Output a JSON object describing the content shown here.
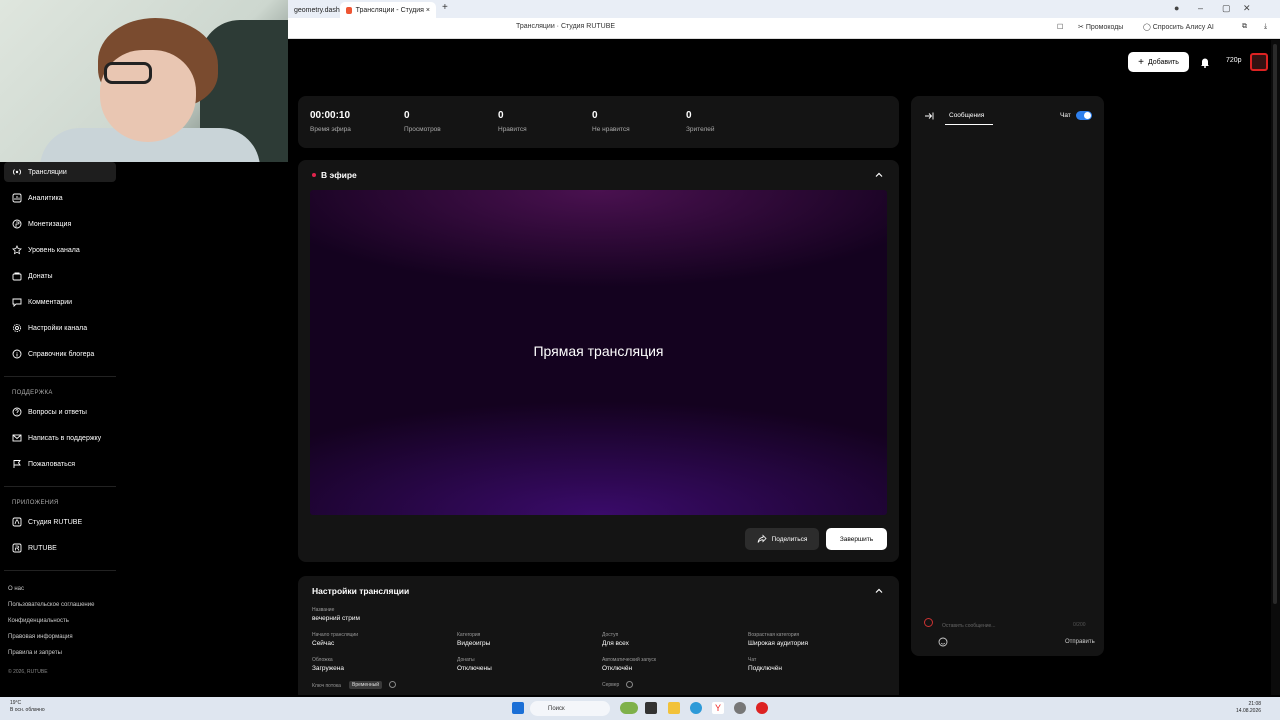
{
  "browser": {
    "tabs": [
      {
        "label": "geometry.dash"
      },
      {
        "label": "Трансляции - Студия ×"
      }
    ],
    "page_title": "Трансляции · Студия RUTUBE",
    "toolbar": {
      "promo_label": "Промокоды",
      "alice_label": "Спросить Алису AI"
    }
  },
  "header": {
    "add_label": "Добавить",
    "quality": "720p"
  },
  "sidebar": {
    "items": [
      {
        "label": "Трансляции",
        "icon": "broadcast-icon"
      },
      {
        "label": "Аналитика",
        "icon": "analytics-icon"
      },
      {
        "label": "Монетизация",
        "icon": "money-icon"
      },
      {
        "label": "Уровень канала",
        "icon": "star-icon"
      },
      {
        "label": "Донаты",
        "icon": "donate-icon"
      },
      {
        "label": "Комментарии",
        "icon": "comment-icon"
      },
      {
        "label": "Настройки канала",
        "icon": "gear-icon"
      },
      {
        "label": "Справочник блогера",
        "icon": "info-icon"
      }
    ],
    "support_label": "ПОДДЕРЖКА",
    "support_items": [
      {
        "label": "Вопросы и ответы",
        "icon": "question-icon"
      },
      {
        "label": "Написать в поддержку",
        "icon": "mail-icon"
      },
      {
        "label": "Пожаловаться",
        "icon": "flag-icon"
      }
    ],
    "apps_label": "ПРИЛОЖЕНИЯ",
    "apps_items": [
      {
        "label": "Студия RUTUBE",
        "icon": "grid-icon"
      },
      {
        "label": "RUTUBE",
        "icon": "grid-icon"
      }
    ],
    "footer_links": [
      "О нас",
      "Пользовательское соглашение",
      "Конфиденциальность",
      "Правовая информация",
      "Правила и запреты"
    ],
    "copyright": "© 2026, RUTUBE"
  },
  "stats": [
    {
      "value": "00:00:10",
      "label": "Время эфира"
    },
    {
      "value": "0",
      "label": "Просмотров"
    },
    {
      "value": "0",
      "label": "Нравится"
    },
    {
      "value": "0",
      "label": "Не нравится"
    },
    {
      "value": "0",
      "label": "Зрителей"
    }
  ],
  "live": {
    "title": "В эфире",
    "player_text": "Прямая трансляция",
    "share_label": "Поделиться",
    "end_label": "Завершить",
    "status_color": "#e0244c"
  },
  "settings": {
    "title": "Настройки трансляции",
    "name_label": "Название",
    "name_value": "вечерний стрим",
    "fields": [
      {
        "label": "Начало трансляции",
        "value": "Сейчас"
      },
      {
        "label": "Категория",
        "value": "Видеоигры"
      },
      {
        "label": "Доступ",
        "value": "Для всех"
      },
      {
        "label": "Возрастная категория",
        "value": "Широкая аудитория"
      },
      {
        "label": "Обложка",
        "value": "Загружена"
      },
      {
        "label": "Донаты",
        "value": "Отключены"
      },
      {
        "label": "Автоматический запуск",
        "value": "Отключён"
      },
      {
        "label": "Чат",
        "value": "Подключён"
      }
    ],
    "stream_key_label": "Ключ потока",
    "stream_key_badge": "Временный",
    "server_label": "Сервер"
  },
  "chat": {
    "tab_label": "Сообщения",
    "chat_label": "Чат",
    "input_placeholder": "Оставить сообщение...",
    "counter": "0/200",
    "send_label": "Отправить"
  },
  "taskbar": {
    "weather_temp": "19°C",
    "weather_desc": "В осн. облачно",
    "search_label": "Поиск",
    "time": "21:08",
    "date": "14.08.2026"
  }
}
